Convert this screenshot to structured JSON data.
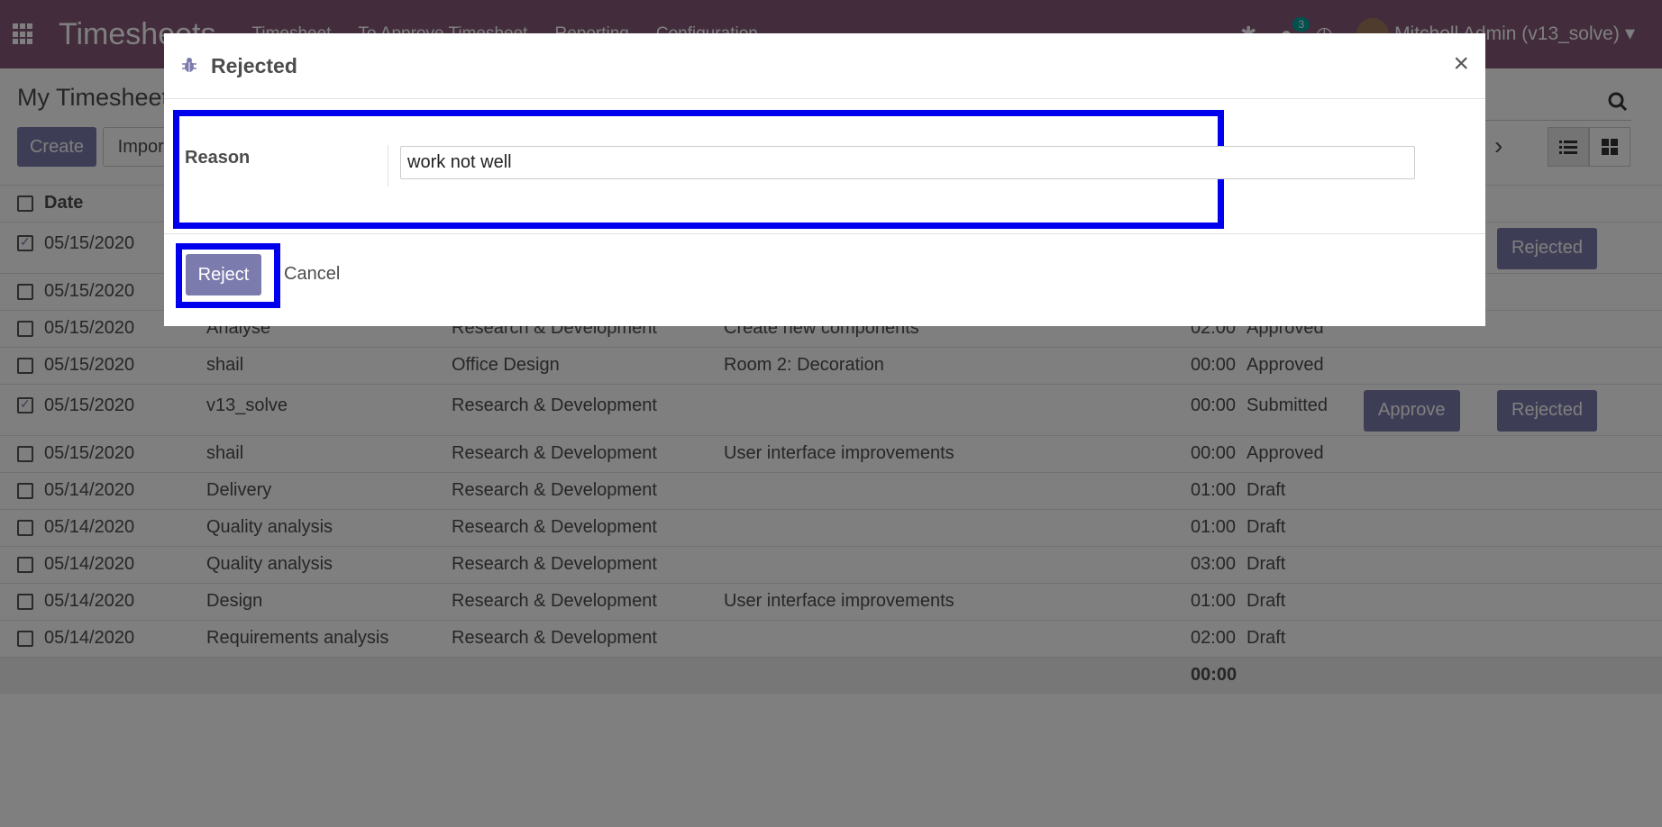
{
  "navbar": {
    "brand": "Timesheets",
    "menu": [
      "Timesheet",
      "To Approve Timesheet",
      "Reporting",
      "Configuration"
    ],
    "chat_count": "3",
    "user": "Mitchell Admin (v13_solve)",
    "bg_color": "#875a7b"
  },
  "control_panel": {
    "breadcrumb": "My Timesheets",
    "create_label": "Create",
    "import_label": "Import"
  },
  "table": {
    "date_header": "Date",
    "rows": [
      {
        "date": "05/15/2020",
        "name": "",
        "project": "",
        "task": "",
        "hours": "",
        "status": "",
        "checked": true,
        "approve": "",
        "rejected": "Rejected"
      },
      {
        "date": "05/15/2020",
        "name": "",
        "project": "",
        "task": "",
        "hours": "",
        "status": "",
        "checked": false,
        "approve": "",
        "rejected": ""
      },
      {
        "date": "05/15/2020",
        "name": "Analyse",
        "project": "Research & Development",
        "task": "Create new components",
        "hours": "02:00",
        "status": "Approved",
        "checked": false,
        "approve": "",
        "rejected": ""
      },
      {
        "date": "05/15/2020",
        "name": "shail",
        "project": "Office Design",
        "task": "Room 2: Decoration",
        "hours": "00:00",
        "status": "Approved",
        "checked": false,
        "approve": "",
        "rejected": ""
      },
      {
        "date": "05/15/2020",
        "name": "v13_solve",
        "project": "Research & Development",
        "task": "",
        "hours": "00:00",
        "status": "Submitted",
        "checked": true,
        "approve": "Approve",
        "rejected": "Rejected"
      },
      {
        "date": "05/15/2020",
        "name": "shail",
        "project": "Research & Development",
        "task": "User interface improvements",
        "hours": "00:00",
        "status": "Approved",
        "checked": false,
        "approve": "",
        "rejected": ""
      },
      {
        "date": "05/14/2020",
        "name": "Delivery",
        "project": "Research & Development",
        "task": "",
        "hours": "01:00",
        "status": "Draft",
        "checked": false,
        "approve": "",
        "rejected": ""
      },
      {
        "date": "05/14/2020",
        "name": "Quality analysis",
        "project": "Research & Development",
        "task": "",
        "hours": "01:00",
        "status": "Draft",
        "checked": false,
        "approve": "",
        "rejected": ""
      },
      {
        "date": "05/14/2020",
        "name": "Quality analysis",
        "project": "Research & Development",
        "task": "",
        "hours": "03:00",
        "status": "Draft",
        "checked": false,
        "approve": "",
        "rejected": ""
      },
      {
        "date": "05/14/2020",
        "name": "Design",
        "project": "Research & Development",
        "task": "User interface improvements",
        "hours": "01:00",
        "status": "Draft",
        "checked": false,
        "approve": "",
        "rejected": ""
      },
      {
        "date": "05/14/2020",
        "name": "Requirements analysis",
        "project": "Research & Development",
        "task": "",
        "hours": "02:00",
        "status": "Draft",
        "checked": false,
        "approve": "",
        "rejected": ""
      }
    ],
    "total": "00:00"
  },
  "modal": {
    "title": "Rejected",
    "reason_label": "Reason",
    "reason_value": "work not well",
    "reject_label": "Reject",
    "cancel_label": "Cancel",
    "close_symbol": "×",
    "accent_color": "#7c7bad",
    "highlight_color": "#0000ee"
  }
}
